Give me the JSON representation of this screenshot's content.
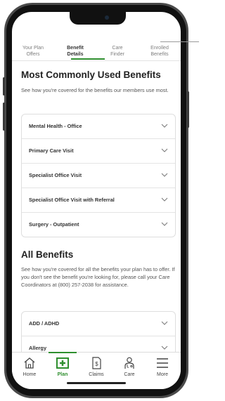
{
  "tabs": [
    {
      "line1": "Your Plan",
      "line2": "Offers",
      "active": false
    },
    {
      "line1": "Benefit",
      "line2": "Details",
      "active": true
    },
    {
      "line1": "Care",
      "line2": "Finder",
      "active": false
    },
    {
      "line1": "Enrolled",
      "line2": "Benefits",
      "active": false
    }
  ],
  "common": {
    "title": "Most Commonly Used Benefits",
    "description": "See how you're covered for the benefits our members use most.",
    "items": [
      {
        "label": "Mental Health - Office"
      },
      {
        "label": "Primary Care Visit"
      },
      {
        "label": "Specialist Office Visit"
      },
      {
        "label": "Specialist Office Visit with Referral"
      },
      {
        "label": "Surgery - Outpatient"
      }
    ]
  },
  "all": {
    "title": "All Benefits",
    "description": "See how you're covered for all the benefits your plan has to offer. If you don't see the benefit you're looking for, please call your Care Coordinators at (800) 257-2038 for assistance.",
    "items": [
      {
        "label": "ADD / ADHD"
      },
      {
        "label": "Allergy"
      }
    ]
  },
  "nav": [
    {
      "label": "Home",
      "icon": "home-icon",
      "active": false
    },
    {
      "label": "Plan",
      "icon": "plan-icon",
      "active": true
    },
    {
      "label": "Claims",
      "icon": "claims-icon",
      "active": false
    },
    {
      "label": "Care",
      "icon": "care-icon",
      "active": false
    },
    {
      "label": "More",
      "icon": "menu-icon",
      "active": false
    }
  ],
  "colors": {
    "accent": "#2f8f2f",
    "text": "#222222",
    "muted": "#7d7d7d"
  }
}
